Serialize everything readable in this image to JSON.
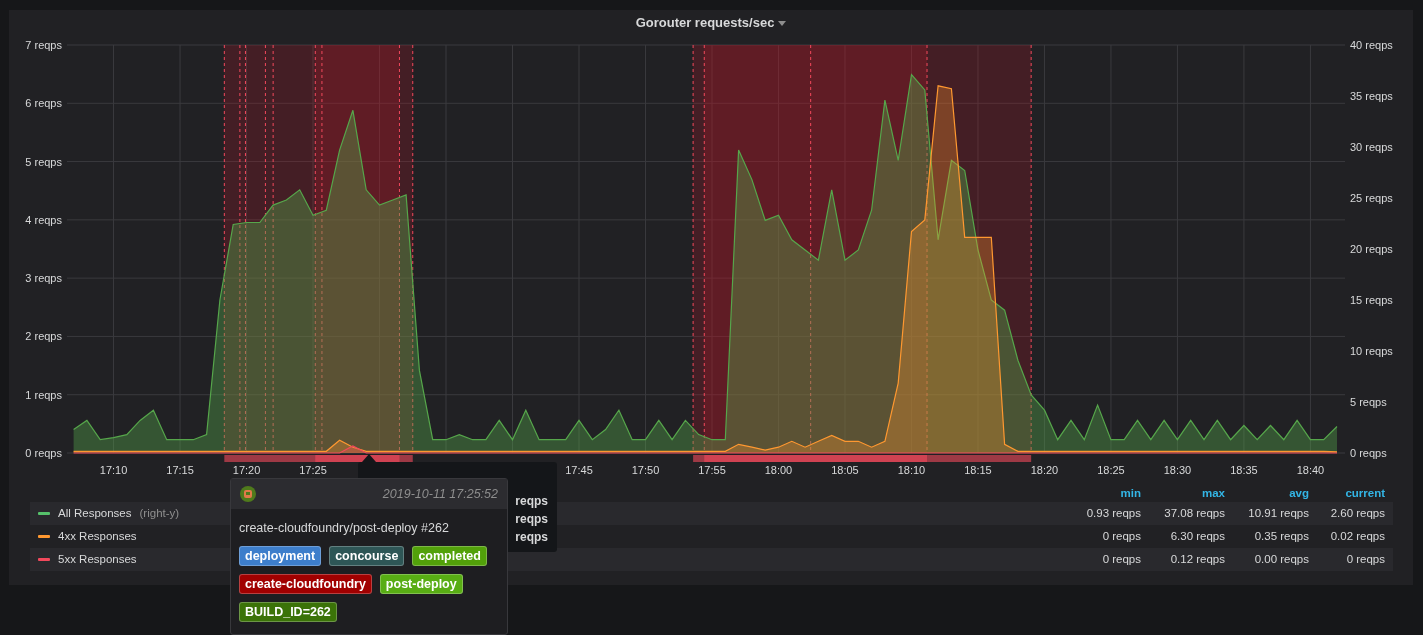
{
  "panel": {
    "title": "Gorouter requests/sec",
    "chart_data": {
      "type": "area",
      "grid": true,
      "ylim": [
        0,
        7
      ],
      "y2lim": [
        0,
        40
      ],
      "categories": [
        null,
        null,
        null,
        "17:10",
        null,
        null,
        null,
        null,
        "17:15",
        null,
        null,
        null,
        null,
        "17:20",
        null,
        null,
        null,
        null,
        "17:25",
        null,
        null,
        null,
        null,
        null,
        null,
        null,
        null,
        null,
        null,
        null,
        null,
        null,
        null,
        null,
        null,
        null,
        null,
        null,
        "17:45",
        null,
        null,
        null,
        null,
        "17:50",
        null,
        null,
        null,
        null,
        "17:55",
        null,
        null,
        null,
        null,
        "18:00",
        null,
        null,
        null,
        null,
        "18:05",
        null,
        null,
        null,
        null,
        "18:10",
        null,
        null,
        null,
        null,
        "18:15",
        null,
        null,
        null,
        null,
        "18:20",
        null,
        null,
        null,
        null,
        "18:25",
        null,
        null,
        null,
        null,
        "18:30",
        null,
        null,
        null,
        null,
        "18:35",
        null,
        null,
        null,
        null,
        "18:40",
        null,
        null
      ],
      "series": [
        {
          "name": "All Responses",
          "color": "#56a64b",
          "axis": "y2",
          "values": [
            2.3,
            3.2,
            1.3,
            1.5,
            1.8,
            3.2,
            4.2,
            1.3,
            1.3,
            1.3,
            1.8,
            15.0,
            22.4,
            22.6,
            22.6,
            24.3,
            24.8,
            25.8,
            23.3,
            23.8,
            29.7,
            33.6,
            25.8,
            24.3,
            24.8,
            25.3,
            8.1,
            1.3,
            1.3,
            1.8,
            1.3,
            1.3,
            3.2,
            1.3,
            4.2,
            1.3,
            1.3,
            1.3,
            3.2,
            1.3,
            2.3,
            4.2,
            1.3,
            1.3,
            3.2,
            1.3,
            3.2,
            1.8,
            1.3,
            1.3,
            29.7,
            26.8,
            22.8,
            23.3,
            20.9,
            19.9,
            18.9,
            25.8,
            18.9,
            19.9,
            23.8,
            34.6,
            28.7,
            37.1,
            35.6,
            20.9,
            28.7,
            27.7,
            19.9,
            15.0,
            14.0,
            9.1,
            5.7,
            4.2,
            1.3,
            3.2,
            1.3,
            4.7,
            1.3,
            1.3,
            3.2,
            1.3,
            3.2,
            1.3,
            3.2,
            1.3,
            3.2,
            1.3,
            2.7,
            1.3,
            2.7,
            1.3,
            3.2,
            1.3,
            1.3,
            2.6
          ]
        },
        {
          "name": "4xx Responses",
          "color": "#ff9830",
          "values": [
            0.03,
            0.03,
            0.03,
            0.03,
            0.03,
            0.03,
            0.03,
            0.03,
            0.03,
            0.03,
            0.03,
            0.03,
            0.03,
            0.03,
            0.03,
            0.03,
            0.03,
            0.03,
            0.03,
            0.03,
            0.22,
            0.1,
            0.03,
            0.03,
            0.03,
            0.03,
            0.03,
            0.03,
            0.03,
            0.03,
            0.03,
            0.03,
            0.03,
            0.03,
            0.03,
            0.03,
            0.03,
            0.03,
            0.03,
            0.03,
            0.03,
            0.03,
            0.03,
            0.03,
            0.03,
            0.03,
            0.03,
            0.03,
            0.03,
            0.03,
            0.15,
            0.1,
            0.05,
            0.1,
            0.2,
            0.1,
            0.2,
            0.3,
            0.2,
            0.2,
            0.1,
            0.2,
            1.2,
            3.8,
            4.0,
            6.3,
            6.25,
            3.7,
            3.7,
            3.7,
            0.15,
            0.03,
            0.03,
            0.03,
            0.03,
            0.03,
            0.03,
            0.03,
            0.03,
            0.03,
            0.03,
            0.03,
            0.03,
            0.03,
            0.03,
            0.03,
            0.03,
            0.03,
            0.03,
            0.03,
            0.03,
            0.03,
            0.03,
            0.03,
            0.03,
            0.02
          ]
        },
        {
          "name": "5xx Responses",
          "color": "#f2495c",
          "values": [
            0,
            0,
            0,
            0,
            0,
            0,
            0,
            0,
            0,
            0,
            0,
            0,
            0,
            0,
            0,
            0,
            0,
            0,
            0,
            0,
            0,
            0.12,
            0,
            0,
            0,
            0,
            0,
            0,
            0,
            0,
            0,
            0,
            0,
            0,
            0,
            0,
            0,
            0,
            0,
            0,
            0,
            0,
            0,
            0,
            0,
            0,
            0,
            0,
            0,
            0,
            0,
            0,
            0,
            0,
            0,
            0,
            0,
            0,
            0,
            0,
            0,
            0,
            0,
            0,
            0,
            0,
            0,
            0,
            0,
            0,
            0,
            0,
            0,
            0,
            0,
            0,
            0,
            0,
            0,
            0,
            0,
            0,
            0,
            0,
            0,
            0,
            0,
            0,
            0,
            0,
            0,
            0,
            0,
            0,
            0,
            0
          ]
        }
      ],
      "yticks": [
        {
          "value": 0,
          "label": "0 reqps"
        },
        {
          "value": 1,
          "label": "1 reqps"
        },
        {
          "value": 2,
          "label": "2 reqps"
        },
        {
          "value": 3,
          "label": "3 reqps"
        },
        {
          "value": 4,
          "label": "4 reqps"
        },
        {
          "value": 5,
          "label": "5 reqps"
        },
        {
          "value": 6,
          "label": "6 reqps"
        },
        {
          "value": 7,
          "label": "7 reqps"
        }
      ],
      "y2ticks": [
        {
          "value": 0,
          "label": "0 reqps"
        },
        {
          "value": 5,
          "label": "5 reqps"
        },
        {
          "value": 10,
          "label": "10 reqps"
        },
        {
          "value": 15,
          "label": "15 reqps"
        },
        {
          "value": 20,
          "label": "20 reqps"
        },
        {
          "value": 25,
          "label": "25 reqps"
        },
        {
          "value": 30,
          "label": "30 reqps"
        },
        {
          "value": 35,
          "label": "35 reqps"
        },
        {
          "value": 40,
          "label": "40 reqps"
        }
      ]
    },
    "legend": {
      "columns": [
        "min",
        "max",
        "avg",
        "current"
      ],
      "rows": [
        {
          "suffix": "(right-y)",
          "color": "#56c16b",
          "min": "0.93 reqps",
          "max": "37.08 reqps",
          "avg": "10.91 reqps",
          "current": "2.60 reqps"
        },
        {
          "color": "#ff9830",
          "min": "0 reqps",
          "max": "6.30 reqps",
          "avg": "0.35 reqps",
          "current": "0.02 reqps"
        },
        {
          "color": "#f2495c",
          "min": "0 reqps",
          "max": "0.12 reqps",
          "avg": "0.00 reqps",
          "current": "0 reqps"
        }
      ]
    },
    "hover_tooltip": {
      "values": [
        "reqps",
        "reqps",
        "reqps"
      ]
    },
    "annotation_tooltip": {
      "time": "2019-10-11 17:25:52",
      "text": "create-cloudfoundry/post-deploy #262",
      "tags": [
        {
          "label": "deployment",
          "color": "#3d7ecb"
        },
        {
          "label": "concourse",
          "color": "#2e5656"
        },
        {
          "label": "completed",
          "color": "#52a10a"
        },
        {
          "label": "create-cloudfoundry",
          "color": "#a10000"
        },
        {
          "label": "post-deploy",
          "color": "#58ad14"
        },
        {
          "label": "BUILD_ID=262",
          "color": "#3b7308"
        }
      ]
    }
  }
}
